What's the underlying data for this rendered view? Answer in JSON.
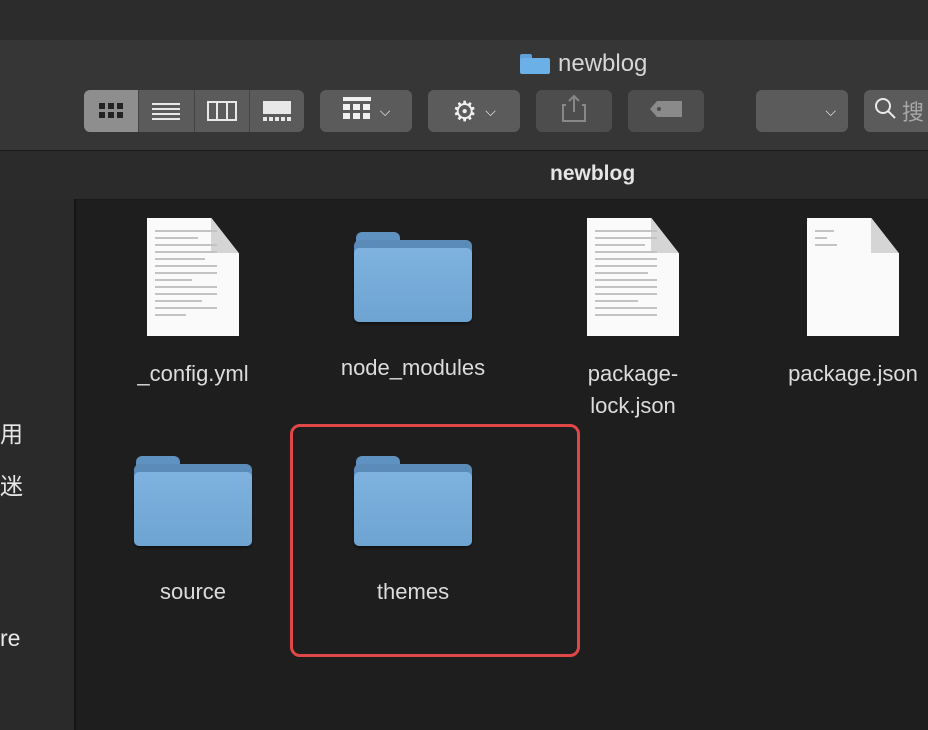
{
  "window": {
    "title": "newblog"
  },
  "toolbar": {
    "view_modes": [
      "icon-view-icon",
      "list-view-icon",
      "column-view-icon",
      "gallery-view-icon"
    ],
    "group_button_icon": "grid-group-icon",
    "action_button_icon": "gear-icon",
    "share_button_icon": "share-icon",
    "tag_button_icon": "tag-icon",
    "search_placeholder": "搜"
  },
  "path_bar": {
    "label": "newblog"
  },
  "sidebar": {
    "fragments": [
      "用",
      "迷",
      "re"
    ]
  },
  "files": [
    {
      "name": "_config.yml",
      "kind": "document"
    },
    {
      "name": "node_modules",
      "kind": "folder"
    },
    {
      "name": "package-\nlock.json",
      "kind": "document"
    },
    {
      "name": "package.json",
      "kind": "document"
    },
    {
      "name": "source",
      "kind": "folder"
    },
    {
      "name": "themes",
      "kind": "folder",
      "highlighted": true
    }
  ],
  "colors": {
    "highlight": "#e04848",
    "folder": "#6ea4d2"
  }
}
